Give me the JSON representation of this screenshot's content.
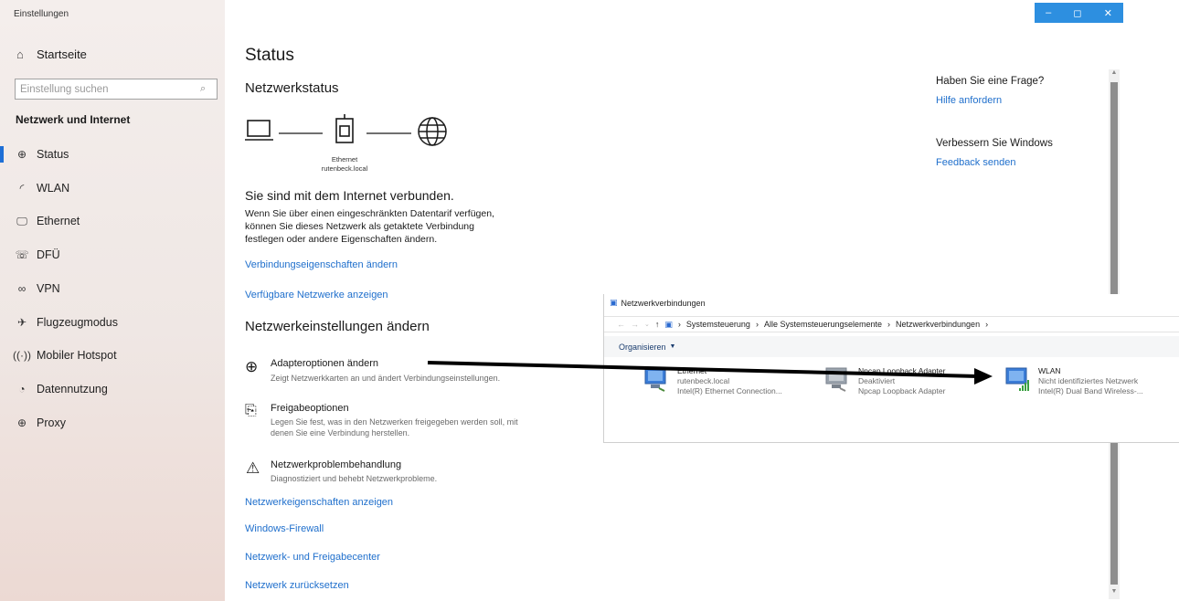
{
  "window": {
    "title": "Einstellungen",
    "controls": [
      "–",
      "◻",
      "✕"
    ]
  },
  "sidebar": {
    "home": "Startseite",
    "search_placeholder": "Einstellung suchen",
    "section": "Netzwerk und Internet",
    "items": [
      {
        "label": "Status",
        "icon": "globe-icon"
      },
      {
        "label": "WLAN",
        "icon": "wifi-icon"
      },
      {
        "label": "Ethernet",
        "icon": "ethernet-icon"
      },
      {
        "label": "DFÜ",
        "icon": "dialup-icon"
      },
      {
        "label": "VPN",
        "icon": "vpn-icon"
      },
      {
        "label": "Flugzeugmodus",
        "icon": "airplane-icon"
      },
      {
        "label": "Mobiler Hotspot",
        "icon": "hotspot-icon"
      },
      {
        "label": "Datennutzung",
        "icon": "datausage-icon"
      },
      {
        "label": "Proxy",
        "icon": "globe-icon"
      }
    ]
  },
  "main": {
    "title": "Status",
    "network_status_heading": "Netzwerkstatus",
    "diagram_label_line1": "Ethernet",
    "diagram_label_line2": "rutenbeck.local",
    "connected_text": "Sie sind mit dem Internet verbunden.",
    "metered_text_1": "Wenn Sie über einen eingeschränkten Datentarif verfügen,",
    "metered_text_2": "können Sie dieses Netzwerk als getaktete Verbindung",
    "metered_text_3": "festlegen oder andere Eigenschaften ändern.",
    "link_change_props": "Verbindungseigenschaften ändern",
    "link_show_networks": "Verfügbare Netzwerke anzeigen",
    "change_settings_heading": "Netzwerkeinstellungen ändern",
    "options": [
      {
        "title": "Adapteroptionen ändern",
        "desc": "Zeigt Netzwerkkarten an und ändert Verbindungseinstellungen."
      },
      {
        "title": "Freigabeoptionen",
        "desc1": "Legen Sie fest, was in den Netzwerken freigegeben werden soll, mit",
        "desc2": "denen Sie eine Verbindung herstellen."
      },
      {
        "title": "Netzwerkproblembehandlung",
        "desc": "Diagnostiziert und behebt Netzwerkprobleme."
      }
    ],
    "links_bottom": [
      "Netzwerkeigenschaften anzeigen",
      "Windows-Firewall",
      "Netzwerk- und Freigabecenter",
      "Netzwerk zurücksetzen"
    ]
  },
  "help": {
    "question": "Haben Sie eine Frage?",
    "help_link": "Hilfe anfordern",
    "improve": "Verbessern Sie Windows",
    "feedback_link": "Feedback senden"
  },
  "netconn": {
    "title": "Netzwerkverbindungen",
    "breadcrumb": [
      "Systemsteuerung",
      "Alle Systemsteuerungselemente",
      "Netzwerkverbindungen"
    ],
    "organize": "Organisieren",
    "adapters": [
      {
        "name": "Ethernet",
        "status": "rutenbeck.local",
        "device": "Intel(R) Ethernet Connection..."
      },
      {
        "name": "Npcap Loopback Adapter",
        "status": "Deaktiviert",
        "device": "Npcap Loopback Adapter"
      },
      {
        "name": "WLAN",
        "status": "Nicht identifiziertes Netzwerk",
        "device": "Intel(R) Dual Band Wireless-..."
      }
    ]
  },
  "colors": {
    "accent": "#1e6fd6",
    "link": "#1f6fcc",
    "titlebar_controls": "#2d8fe0"
  }
}
